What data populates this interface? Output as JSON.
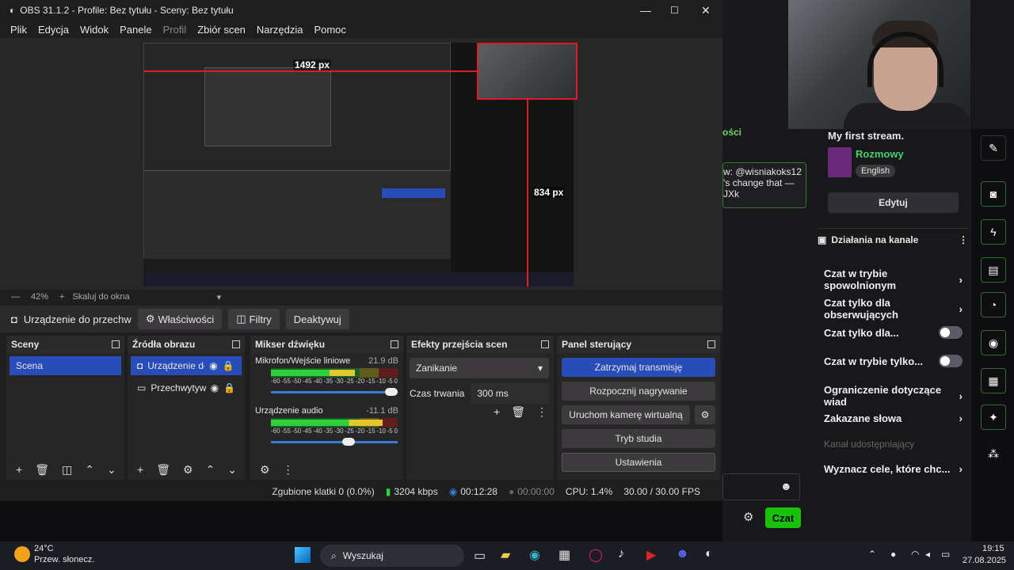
{
  "window": {
    "title": "OBS 31.1.2 - Profile: Bez tytułu - Sceny: Bez tytułu"
  },
  "menu": [
    "Plik",
    "Edycja",
    "Widok",
    "Panele",
    "Profil",
    "Zbiór scen",
    "Narzędzia",
    "Pomoc"
  ],
  "preview": {
    "width_label": "1492 px",
    "height_label": "834 px"
  },
  "zoom": {
    "level": "42%",
    "fit_label": "Skaluj do okna"
  },
  "source_toolbar": {
    "selected_source": "Urządzenie do przechwyty",
    "properties": "Właściwości",
    "filters": "Filtry",
    "deactivate": "Deaktywuj"
  },
  "docks": {
    "scenes": {
      "title": "Sceny",
      "items": [
        "Scena"
      ]
    },
    "sources": {
      "title": "Źródła obrazu",
      "items": [
        "Urządzenie do",
        "Przechwytywa"
      ]
    },
    "mixer": {
      "title": "Mikser dźwięku",
      "channels": [
        {
          "name": "Mikrofon/Wejście liniowe",
          "db": "21.9 dB",
          "level": 0.66
        },
        {
          "name": "Urządzenie audio",
          "db": "-11.1 dB",
          "level": 0.88
        }
      ],
      "scale": [
        "-60",
        "-55",
        "-50",
        "-45",
        "-40",
        "-35",
        "-30",
        "-25",
        "-20",
        "-15",
        "-10",
        "-5",
        "0"
      ]
    },
    "transitions": {
      "title": "Efekty przejścia scen",
      "effect": "Zanikanie",
      "duration_label": "Czas trwania",
      "duration": "300 ms"
    },
    "controls": {
      "title": "Panel sterujący",
      "stop_stream": "Zatrzymaj transmisję",
      "start_recording": "Rozpocznij nagrywanie",
      "virtual_cam": "Uruchom kamerę wirtualną",
      "studio_mode": "Tryb studia",
      "settings": "Ustawienia"
    }
  },
  "status": {
    "dropped": "Zgubione klatki 0 (0.0%)",
    "bitrate": "3204 kbps",
    "stream_time": "00:12:28",
    "rec_time": "00:00:00",
    "cpu": "CPU: 1.4%",
    "fps": "30.00 / 30.00 FPS"
  },
  "chat_page": {
    "stream_title": "My first stream.",
    "category": "Rozmowy",
    "language": "English",
    "edit": "Edytuj",
    "actions_title": "Działania na kanale",
    "settings": [
      "Czat w trybie spowolnionym",
      "Czat tylko dla obserwujących",
      "Czat tylko dla...",
      "Czat w trybie tylko...",
      "Ograniczenie dotyczące wiad",
      "Zakazane słowa",
      "Kanał udostępniający",
      "Wyznacz cele, które chc..."
    ],
    "message": "w: @wisniakoks12",
    "message2": "'s change that —",
    "message3": "JXk",
    "section": "ości",
    "chat_button": "Czat"
  },
  "taskbar": {
    "weather_temp": "24°C",
    "weather_desc": "Przew. słonecz.",
    "search": "Wyszukaj",
    "time": "19:15",
    "date": "27.08.2025"
  }
}
